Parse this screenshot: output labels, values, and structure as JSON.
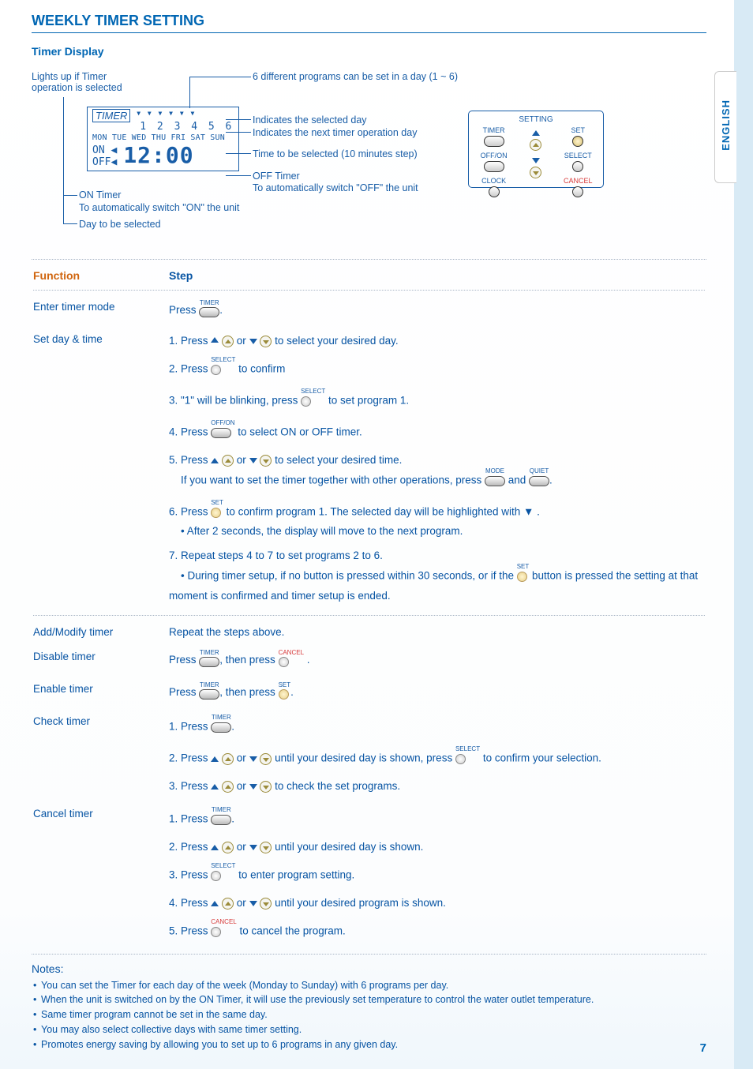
{
  "page": {
    "title": "WEEKLY TIMER SETTING",
    "subtitle": "Timer Display",
    "language_tab": "ENGLISH",
    "page_number": "7"
  },
  "diagram": {
    "lights_up": "Lights up if Timer operation is selected",
    "programs_note": "6 different programs can be set in a day (1 ~ 6)",
    "timer_box_label": "TIMER",
    "program_numbers": "1 2 3 4 5 6",
    "days": "MON TUE WED THU FRI SAT SUN",
    "on_label": "ON ◀",
    "off_label": "OFF◀",
    "time_display": "12:00",
    "indicates_selected_day": "Indicates the selected day",
    "indicates_next_day": "Indicates the next timer operation day",
    "time_selected": "Time to be selected (10 minutes step)",
    "off_timer": "OFF Timer",
    "off_timer_sub": "To automatically switch \"OFF\" the unit",
    "on_timer": "ON Timer",
    "on_timer_sub": "To automatically switch \"ON\" the unit",
    "day_selected": "Day to be selected"
  },
  "remote": {
    "setting_label": "SETTING",
    "timer_label": "TIMER",
    "offon_label": "OFF/ON",
    "clock_label": "CLOCK",
    "set_label": "SET",
    "select_label": "SELECT",
    "cancel_label": "CANCEL"
  },
  "table": {
    "function_header": "Function",
    "step_header": "Step",
    "rows": [
      {
        "func": "Enter timer mode",
        "key": "enter"
      },
      {
        "func": "Set day & time",
        "key": "setday"
      },
      {
        "func": "Add/Modify timer",
        "key": "addmod"
      },
      {
        "func": "Disable timer",
        "key": "disable"
      },
      {
        "func": "Enable timer",
        "key": "enable"
      },
      {
        "func": "Check timer",
        "key": "check"
      },
      {
        "func": "Cancel timer",
        "key": "cancel"
      }
    ]
  },
  "steps": {
    "enter": {
      "press": "Press ",
      "timer_lab": "TIMER"
    },
    "setday": {
      "s1a": "1. Press ",
      "s1b": " or ",
      "s1c": " to select your desired day.",
      "s2a": "2.  Press ",
      "s2b": " to confirm",
      "select_lab": "SELECT",
      "s3a": "3. \"1\" will be blinking, press ",
      "s3b": " to set program 1.",
      "s4a": "4. Press ",
      "s4b": " to select ON or OFF timer.",
      "offon_lab": "OFF/ON",
      "s5a": "5. Press ",
      "s5b": " or ",
      "s5c": " to select your desired time.",
      "s5d": "If you want to set the timer together with other operations, press ",
      "s5e": " and ",
      "mode_lab": "MODE",
      "quiet_lab": "QUIET",
      "s6a": "6. Press ",
      "s6b": " to confirm program 1. The selected day will be highlighted with ▼ .",
      "set_lab": "SET",
      "s6c": "• After 2 seconds, the display will move to the next program.",
      "s7a": "7. Repeat steps 4 to 7 to set programs 2 to 6.",
      "s7b": "• During timer setup, if no button is pressed within 30 seconds, or if the ",
      "s7c": " button is pressed the setting at that moment is confirmed and timer setup is ended."
    },
    "addmod": {
      "text": "Repeat the steps above."
    },
    "disable": {
      "a": "Press ",
      "b": ", then press ",
      "cancel_lab": "CANCEL",
      "timer_lab": "TIMER"
    },
    "enable": {
      "a": "Press ",
      "b": ", then press ",
      "set_lab": "SET",
      "timer_lab": "TIMER"
    },
    "check": {
      "s1": "1. Press ",
      "timer_lab": "TIMER",
      "s2a": "2. Press ",
      "s2b": " or ",
      "s2c": " until your desired day is shown, press ",
      "s2d": " to confirm your selection.",
      "select_lab": "SELECT",
      "s3a": "3. Press ",
      "s3b": " or ",
      "s3c": " to check the set programs."
    },
    "cancel": {
      "s1": "1. Press ",
      "timer_lab": "TIMER",
      "s2a": "2. Press ",
      "s2b": " or ",
      "s2c": " until your desired day is shown.",
      "s3a": "3.  Press ",
      "s3b": " to enter program setting.",
      "select_lab": "SELECT",
      "s4a": "4. Press ",
      "s4b": " or ",
      "s4c": " until your desired program is shown.",
      "s5a": "5.  Press ",
      "s5b": " to cancel the program.",
      "cancel_lab": "CANCEL"
    }
  },
  "notes": {
    "heading": "Notes:",
    "items": [
      "You can set the Timer for each day of the week (Monday to Sunday) with 6 programs per day.",
      "When the unit is switched on by the ON Timer, it will use the previously set temperature to control the water outlet temperature.",
      "Same timer program cannot be set in the same day.",
      "You may also select collective days with same timer setting.",
      "Promotes energy saving by allowing you to set up to 6 programs in any given day."
    ]
  }
}
